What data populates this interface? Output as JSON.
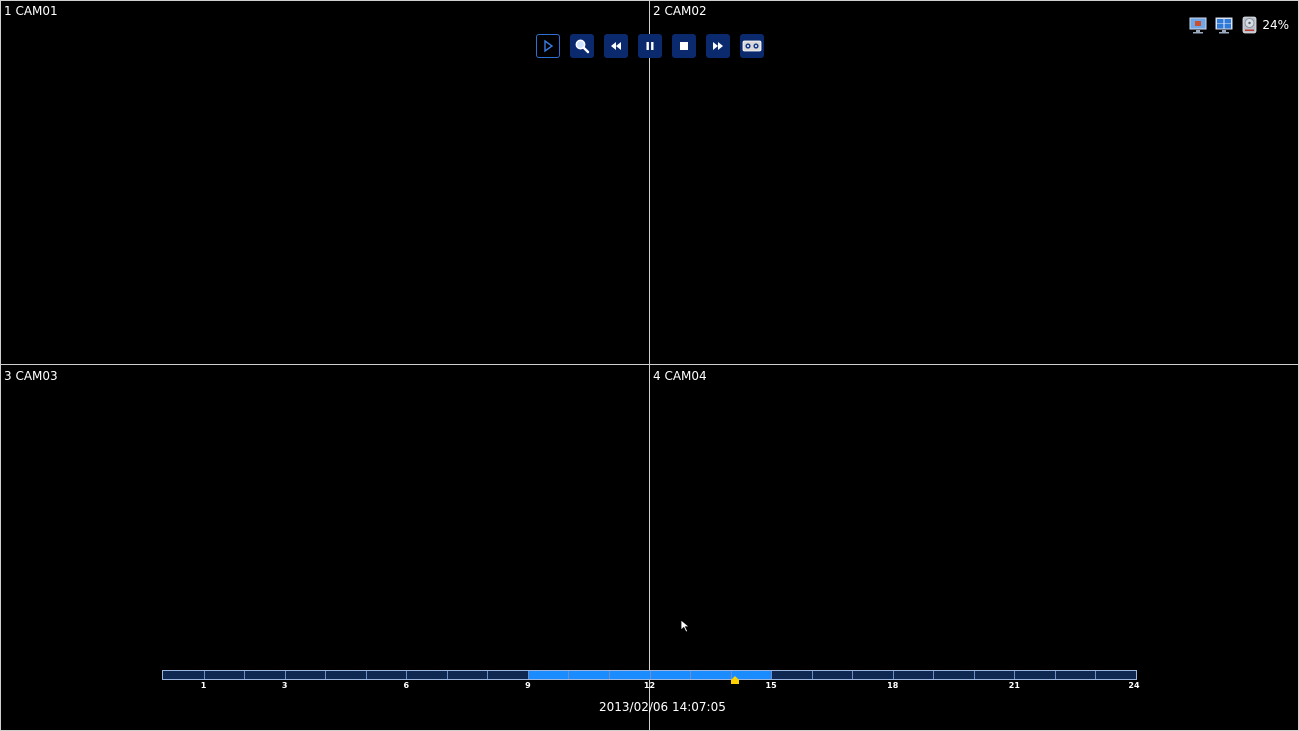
{
  "cameras": [
    {
      "label": "1 CAM01"
    },
    {
      "label": "2 CAM02"
    },
    {
      "label": "3 CAM03"
    },
    {
      "label": "4 CAM04"
    }
  ],
  "toolbar": {
    "buttons": [
      "play-icon",
      "zoom-icon",
      "rewind-icon",
      "pause-icon",
      "stop-icon",
      "fast-forward-icon",
      "backup-icon"
    ],
    "accent": "#0b2a6e"
  },
  "status": {
    "disk_usage": "24%"
  },
  "timeline": {
    "hour_labels": [
      {
        "hour": 1,
        "text": "1"
      },
      {
        "hour": 3,
        "text": "3"
      },
      {
        "hour": 6,
        "text": "6"
      },
      {
        "hour": 9,
        "text": "9"
      },
      {
        "hour": 12,
        "text": "12"
      },
      {
        "hour": 15,
        "text": "15"
      },
      {
        "hour": 18,
        "text": "18"
      },
      {
        "hour": 21,
        "text": "21"
      },
      {
        "hour": 24,
        "text": "24"
      }
    ],
    "recorded_ranges": [
      [
        9,
        15
      ]
    ],
    "current_hour": 14.12,
    "recorded_color": "#1a8cff",
    "cursor_color": "#ffd200"
  },
  "datetime": "2013/02/06 14:07:05"
}
